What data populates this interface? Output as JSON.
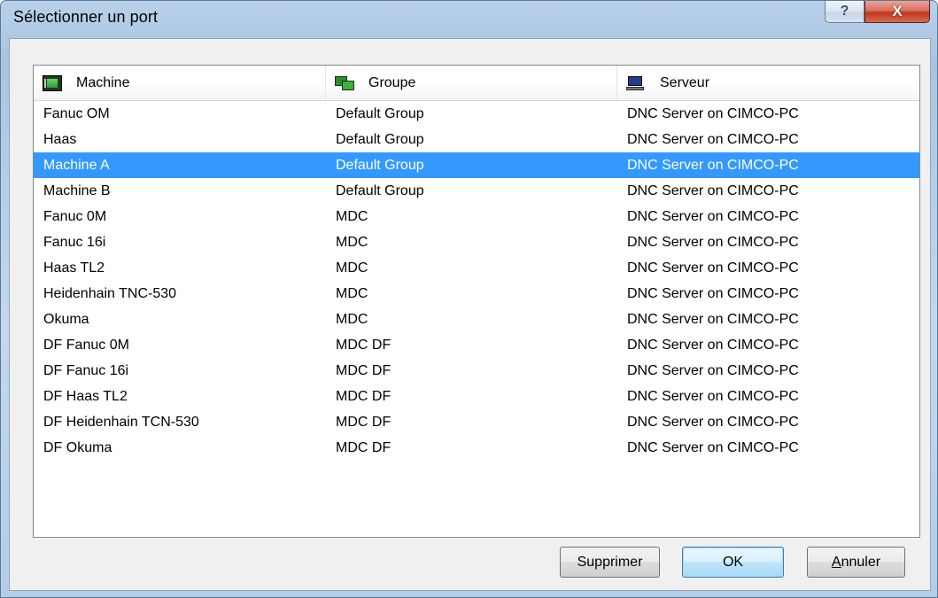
{
  "window": {
    "title": "Sélectionner un port",
    "help_label": "?",
    "close_label": "X"
  },
  "list": {
    "columns": [
      {
        "label": "Machine",
        "icon": "machine-icon"
      },
      {
        "label": "Groupe",
        "icon": "group-icon"
      },
      {
        "label": "Serveur",
        "icon": "server-icon"
      }
    ],
    "selected_index": 2,
    "rows": [
      {
        "machine": "Fanuc OM",
        "group": "Default Group",
        "server": "DNC Server on CIMCO-PC"
      },
      {
        "machine": "Haas",
        "group": "Default Group",
        "server": "DNC Server on CIMCO-PC"
      },
      {
        "machine": "Machine A",
        "group": "Default Group",
        "server": "DNC Server on CIMCO-PC"
      },
      {
        "machine": "Machine B",
        "group": "Default Group",
        "server": "DNC Server on CIMCO-PC"
      },
      {
        "machine": "Fanuc 0M",
        "group": "MDC",
        "server": "DNC Server on CIMCO-PC"
      },
      {
        "machine": "Fanuc 16i",
        "group": "MDC",
        "server": "DNC Server on CIMCO-PC"
      },
      {
        "machine": "Haas TL2",
        "group": "MDC",
        "server": "DNC Server on CIMCO-PC"
      },
      {
        "machine": "Heidenhain TNC-530",
        "group": "MDC",
        "server": "DNC Server on CIMCO-PC"
      },
      {
        "machine": "Okuma",
        "group": "MDC",
        "server": "DNC Server on CIMCO-PC"
      },
      {
        "machine": "DF Fanuc 0M",
        "group": "MDC DF",
        "server": "DNC Server on CIMCO-PC"
      },
      {
        "machine": "DF Fanuc 16i",
        "group": "MDC DF",
        "server": "DNC Server on CIMCO-PC"
      },
      {
        "machine": "DF Haas TL2",
        "group": "MDC DF",
        "server": "DNC Server on CIMCO-PC"
      },
      {
        "machine": "DF Heidenhain TCN-530",
        "group": "MDC DF",
        "server": "DNC Server on CIMCO-PC"
      },
      {
        "machine": "DF Okuma",
        "group": "MDC DF",
        "server": "DNC Server on CIMCO-PC"
      }
    ]
  },
  "buttons": {
    "delete_label": "Supprimer",
    "ok_label": "OK",
    "cancel_mnemonic": "A",
    "cancel_rest": "nnuler"
  },
  "colors": {
    "selection": "#3399ff",
    "close_button": "#c2361d",
    "title_bar": "#b9d1ea"
  }
}
